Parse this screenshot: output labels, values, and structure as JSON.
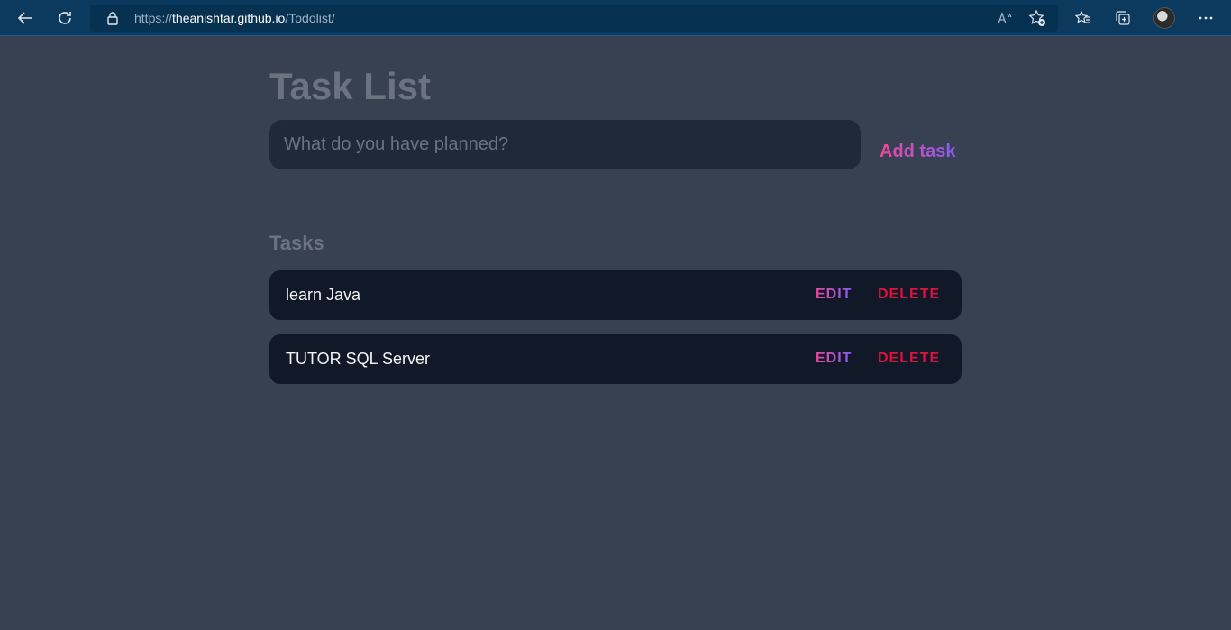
{
  "browser": {
    "url_prefix": "https://",
    "url_host": "theanishtar.github.io",
    "url_path": "/Todolist/",
    "icons": [
      "back-icon",
      "refresh-icon",
      "lock-icon",
      "read-aloud-icon",
      "add-favorite-icon",
      "favorites-icon",
      "collections-icon",
      "profile-avatar",
      "more-icon"
    ]
  },
  "page": {
    "title": "Task List",
    "input_placeholder": "What do you have planned?",
    "add_button_label": "Add task",
    "tasks_heading": "Tasks"
  },
  "tasks": [
    {
      "text": "learn Java",
      "edit_label": "EDIT",
      "delete_label": "DELETE"
    },
    {
      "text": "TUTOR SQL Server",
      "edit_label": "EDIT",
      "delete_label": "DELETE"
    }
  ],
  "colors": {
    "background": "#374151",
    "input_background": "#1f2937",
    "task_background": "#111827",
    "accent_gradient_start": "#ec4899",
    "accent_gradient_end": "#8b5cf6",
    "delete": "#dc143c"
  }
}
